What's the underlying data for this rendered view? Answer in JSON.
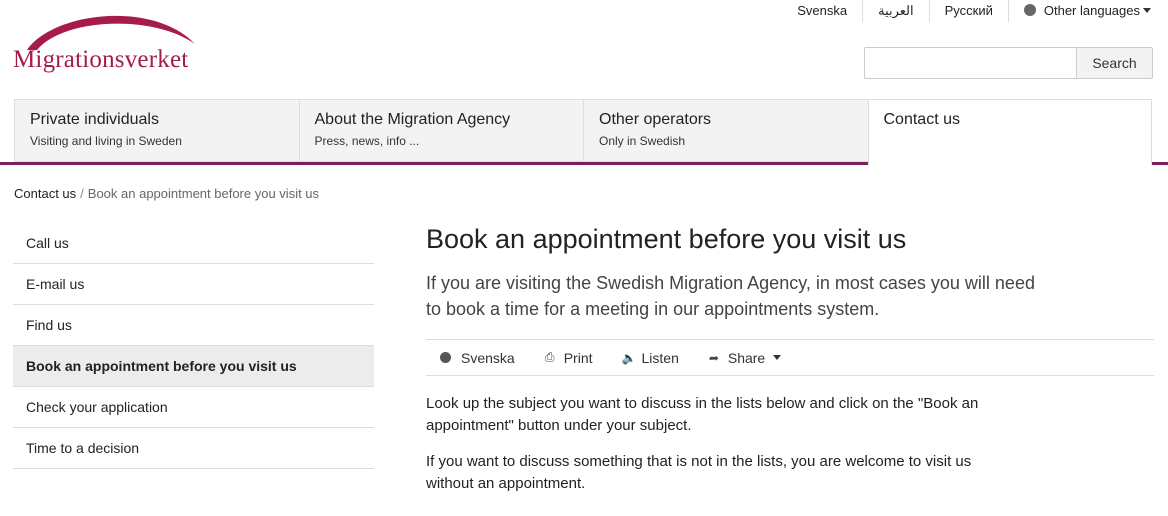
{
  "logo": {
    "text": "Migrationsverket",
    "brand_color": "#a51c48"
  },
  "languages": {
    "items": [
      "Svenska",
      "العربية",
      "Русский"
    ],
    "other_label": "Other languages",
    "other_icon": "globe-icon"
  },
  "search": {
    "placeholder": "",
    "button_label": "Search"
  },
  "main_nav": [
    {
      "title": "Private individuals",
      "subtitle": "Visiting and living in Sweden"
    },
    {
      "title": "About the Migration Agency",
      "subtitle": "Press, news, info ..."
    },
    {
      "title": "Other operators",
      "subtitle": "Only in Swedish"
    },
    {
      "title": "Contact us",
      "subtitle": ""
    }
  ],
  "nav_accent_color": "#7a1f5c",
  "breadcrumb": {
    "parent": "Contact us",
    "separator": "/",
    "current": "Book an appointment before you visit us"
  },
  "sidebar": [
    {
      "label": "Call us"
    },
    {
      "label": "E-mail us"
    },
    {
      "label": "Find us"
    },
    {
      "label": "Book an appointment before you visit us",
      "active": true
    },
    {
      "label": "Check your application"
    },
    {
      "label": "Time to a decision"
    }
  ],
  "content": {
    "title": "Book an appointment before you visit us",
    "lead": "If you are visiting the Swedish Migration Agency, in most cases you will need to book a time for a meeting in our appointments system.",
    "toolbar": {
      "language": "Svenska",
      "print": "Print",
      "listen": "Listen",
      "share": "Share"
    },
    "paragraphs": [
      "Look up the subject you want to discuss in the lists below and click on the \"Book an appointment\" button under your subject.",
      "If you want to discuss something that is not in the lists, you are welcome to visit us without an appointment."
    ]
  }
}
